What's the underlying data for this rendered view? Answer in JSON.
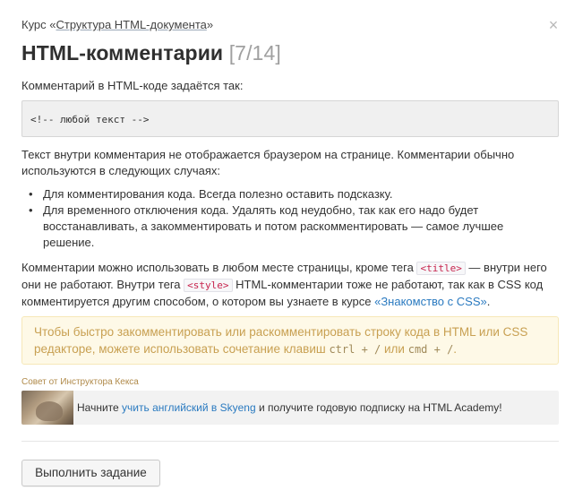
{
  "header": {
    "course_prefix": "Курс «",
    "course_link": "Структура HTML-документа",
    "course_suffix": "»",
    "title": "HTML-комментарии",
    "counter": "[7/14]",
    "close_icon": "×"
  },
  "content": {
    "intro": "Комментарий в HTML-коде задаётся так:",
    "code": "<!-- любой текст -->",
    "para1": "Текст внутри комментария не отображается браузером на странице. Комментарии обычно используются в следующих случаях:",
    "list": [
      "Для комментирования кода. Всегда полезно оставить подсказку.",
      "Для временного отключения кода. Удалять код неудобно, так как его надо будет восстанавливать, а закомментировать и потом раскомментировать — самое лучшее решение."
    ],
    "para2": {
      "t1": "Комментарии можно использовать в любом месте страницы, кроме тега ",
      "tag1": "<title>",
      "t2": " — внутри него они не работают. Внутри тега ",
      "tag2": "<style>",
      "t3": " HTML-комментарии тоже не работают, так как в CSS код комментируется другим способом, о котором вы узнаете в курсе ",
      "link": "«Знакомство с CSS»",
      "t4": "."
    }
  },
  "tip": {
    "t1": "Чтобы быстро закомментировать или раскомментировать строку кода в HTML или CSS редакторе, можете использовать сочетание клавиш ",
    "key1": "ctrl + /",
    "t2": " или ",
    "key2": "cmd + /",
    "t3": "."
  },
  "instructor": {
    "label": "Совет от Инструктора Кекса"
  },
  "promo": {
    "t1": "Начните ",
    "link": "учить английский в Skyeng",
    "t2": " и получите годовую подписку на HTML Academy!"
  },
  "footer": {
    "button_label": "Выполнить задание"
  },
  "colors": {
    "link": "#2a7ac0",
    "tip_bg": "#fef9e7",
    "tip_text": "#c8a052",
    "tag_text": "#c7254e"
  }
}
